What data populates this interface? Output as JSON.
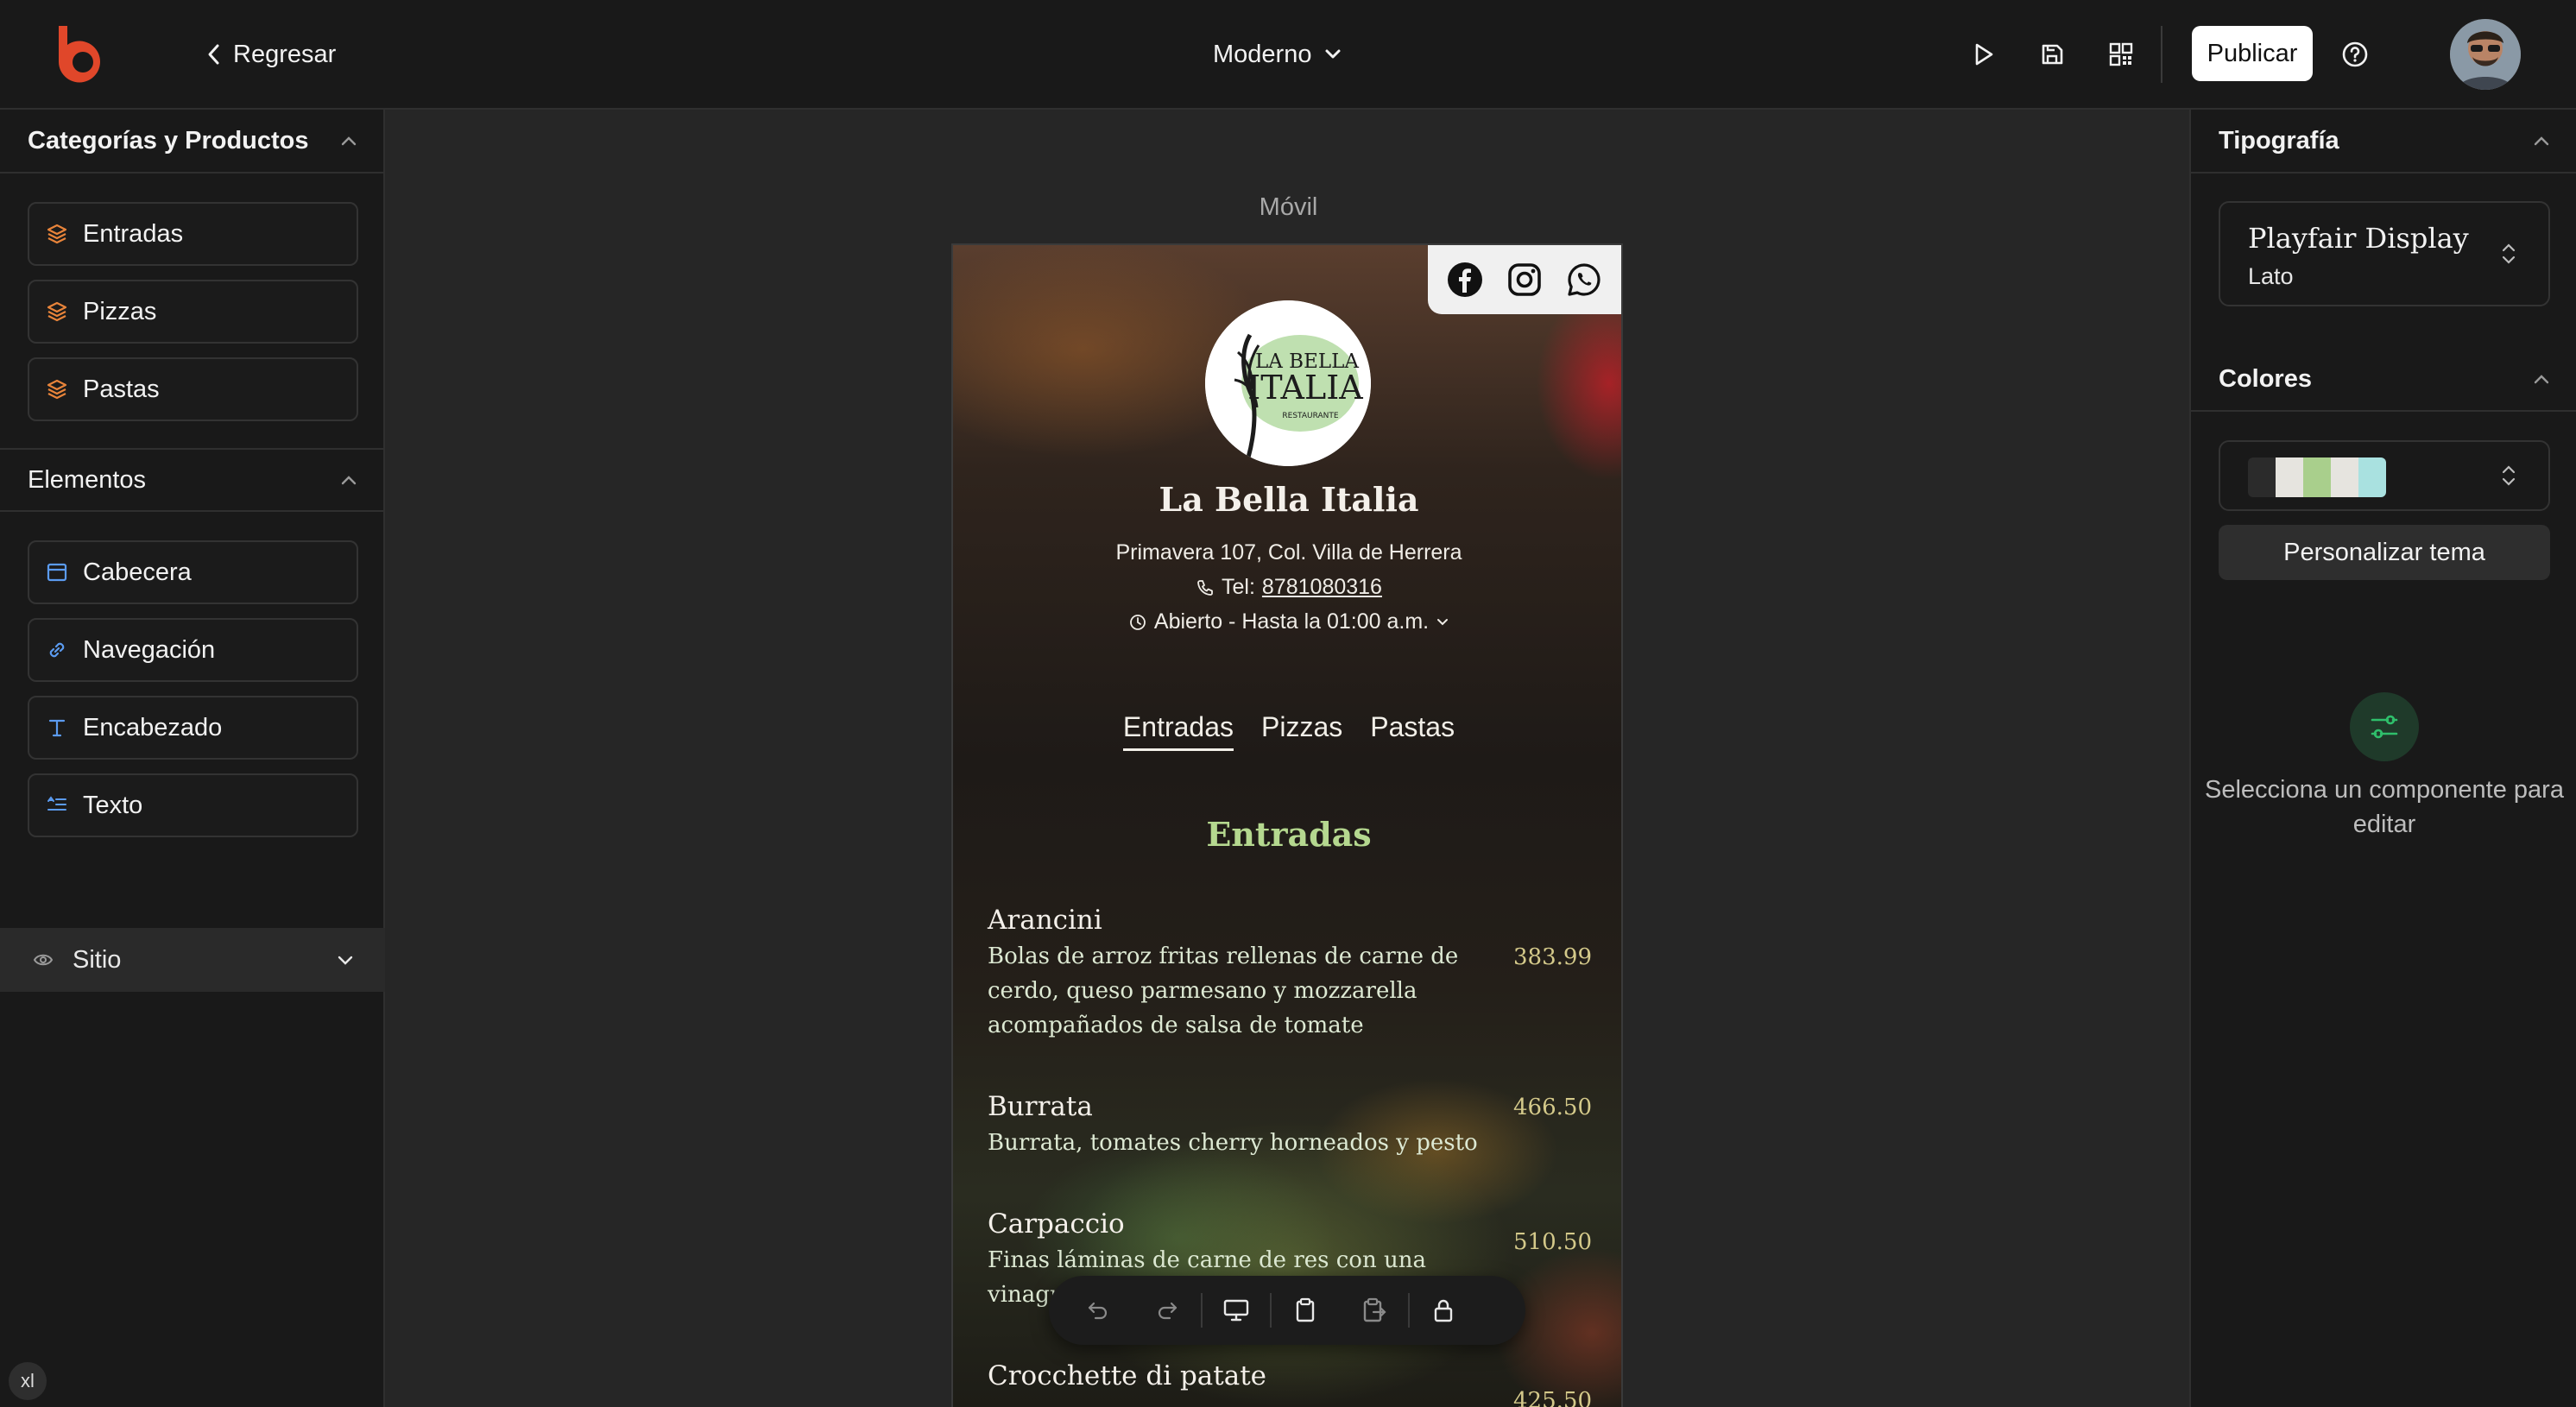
{
  "header": {
    "back_label": "Regresar",
    "template_name": "Moderno",
    "publish_label": "Publicar"
  },
  "left_panel": {
    "categories_title": "Categorías y Productos",
    "categories": [
      {
        "label": "Entradas",
        "icon": "layers-icon"
      },
      {
        "label": "Pizzas",
        "icon": "layers-icon"
      },
      {
        "label": "Pastas",
        "icon": "layers-icon"
      }
    ],
    "elements_title": "Elementos",
    "elements": [
      {
        "label": "Cabecera",
        "icon": "header-icon"
      },
      {
        "label": "Navegación",
        "icon": "link-icon"
      },
      {
        "label": "Encabezado",
        "icon": "type-icon"
      },
      {
        "label": "Texto",
        "icon": "text-lines-icon"
      }
    ],
    "site_label": "Sitio",
    "breakpoint_badge": "xl"
  },
  "canvas": {
    "device_label": "Móvil",
    "restaurant": {
      "name": "La Bella Italia",
      "logo_text_1": "LA BELLA",
      "logo_text_2": "ITALIA",
      "logo_text_3": "RESTAURANTE",
      "address": "Primavera 107, Col. Villa de Herrera",
      "phone_prefix": "Tel:",
      "phone": "8781080316",
      "hours": "Abierto - Hasta la 01:00 a.m."
    },
    "nav": [
      "Entradas",
      "Pizzas",
      "Pastas"
    ],
    "section_title": "Entradas",
    "products": [
      {
        "name": "Arancini",
        "description": "Bolas de arroz fritas rellenas de carne de cerdo, queso parmesano y mozzarella acompañados de salsa de tomate",
        "price": "383.99"
      },
      {
        "name": "Burrata",
        "description": "Burrata, tomates cherry horneados y pesto",
        "price": "466.50"
      },
      {
        "name": "Carpaccio",
        "description": "Finas láminas de carne de res con una vinagreta acomp",
        "price": "510.50"
      },
      {
        "name": "Crocchette di patate",
        "description": "",
        "price": "425.50"
      }
    ]
  },
  "right_panel": {
    "typography_title": "Tipografía",
    "heading_font": "Playfair Display",
    "body_font": "Lato",
    "colors_title": "Colores",
    "palette": [
      "#2b2b2b",
      "#e6e4df",
      "#a9cf8c",
      "#e6e4df",
      "#a9e1e0"
    ],
    "customize_label": "Personalizar tema",
    "empty_state": "Selecciona un componente para editar"
  },
  "colors": {
    "brand": "#e0472a",
    "accent_green": "#b5d88f",
    "empty_icon": "#2fbf6b"
  }
}
